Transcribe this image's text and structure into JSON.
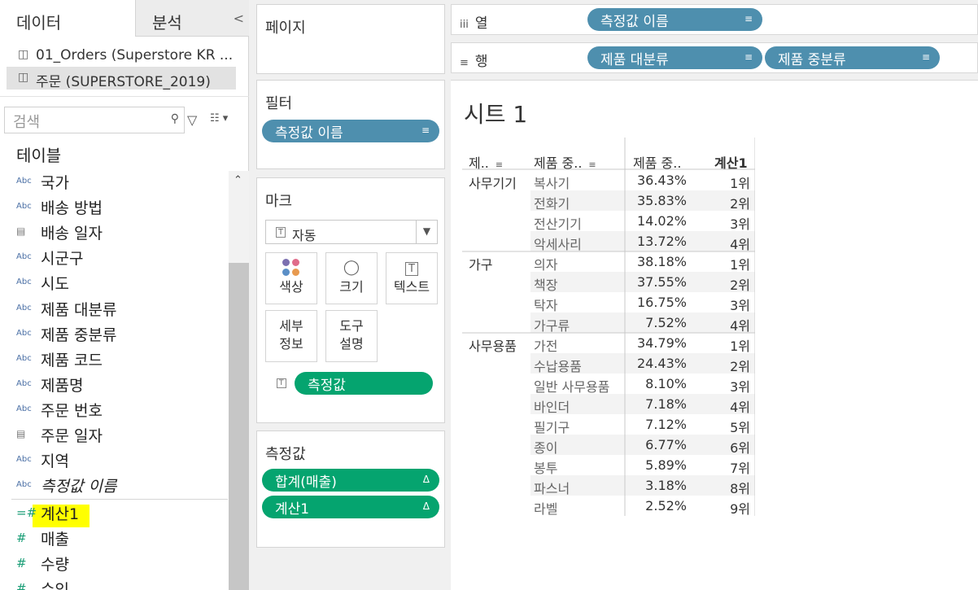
{
  "tabs": {
    "data": "데이터",
    "analysis": "분석",
    "collapse": "<"
  },
  "datasources": [
    "01_Orders (Superstore KR ...",
    "주문 (SUPERSTORE_2019)"
  ],
  "search": {
    "placeholder": "검색"
  },
  "tables_heading": "테이블",
  "fields": [
    {
      "icon": "Abc",
      "name": "국가"
    },
    {
      "icon": "Abc",
      "name": "배송 방법"
    },
    {
      "icon": "cal",
      "name": "배송 일자"
    },
    {
      "icon": "Abc",
      "name": "시군구"
    },
    {
      "icon": "Abc",
      "name": "시도"
    },
    {
      "icon": "Abc",
      "name": "제품 대분류"
    },
    {
      "icon": "Abc",
      "name": "제품 중분류"
    },
    {
      "icon": "Abc",
      "name": "제품 코드"
    },
    {
      "icon": "Abc",
      "name": "제품명"
    },
    {
      "icon": "Abc",
      "name": "주문 번호"
    },
    {
      "icon": "cal",
      "name": "주문 일자"
    },
    {
      "icon": "Abc",
      "name": "지역"
    },
    {
      "icon": "Abc",
      "name": "측정값 이름"
    }
  ],
  "measures": [
    {
      "icon": "=#",
      "name": "계산1"
    },
    {
      "icon": "#",
      "name": "매출"
    },
    {
      "icon": "#",
      "name": "수량"
    },
    {
      "icon": "#",
      "name": "수익"
    }
  ],
  "pages_card": {
    "title": "페이지"
  },
  "filters_card": {
    "title": "필터",
    "pill": "측정값 이름"
  },
  "marks_card": {
    "title": "마크",
    "type": "자동",
    "color": "색상",
    "size": "크기",
    "text": "텍스트",
    "detail_1": "세부",
    "detail_2": "정보",
    "tooltip_1": "도구",
    "tooltip_2": "설명",
    "pill": "측정값"
  },
  "measure_values_card": {
    "title": "측정값",
    "pills": [
      "합계(매출)",
      "계산1"
    ]
  },
  "columns_shelf": {
    "label": "열",
    "pill": "측정값 이름"
  },
  "rows_shelf": {
    "label": "행",
    "pills": [
      "제품 대분류",
      "제품 중분류"
    ]
  },
  "sheet": {
    "title": "시트 1",
    "headers": [
      "제..",
      "제품 중..",
      "제품 중..",
      "계산1"
    ],
    "groups": [
      {
        "category": "사무기기",
        "rows": [
          {
            "sub": "복사기",
            "pct": "36.43%",
            "rank": "1위"
          },
          {
            "sub": "전화기",
            "pct": "35.83%",
            "rank": "2위"
          },
          {
            "sub": "전산기기",
            "pct": "14.02%",
            "rank": "3위"
          },
          {
            "sub": "악세사리",
            "pct": "13.72%",
            "rank": "4위"
          }
        ]
      },
      {
        "category": "가구",
        "rows": [
          {
            "sub": "의자",
            "pct": "38.18%",
            "rank": "1위"
          },
          {
            "sub": "책장",
            "pct": "37.55%",
            "rank": "2위"
          },
          {
            "sub": "탁자",
            "pct": "16.75%",
            "rank": "3위"
          },
          {
            "sub": "가구류",
            "pct": "7.52%",
            "rank": "4위"
          }
        ]
      },
      {
        "category": "사무용품",
        "rows": [
          {
            "sub": "가전",
            "pct": "34.79%",
            "rank": "1위"
          },
          {
            "sub": "수납용품",
            "pct": "24.43%",
            "rank": "2위"
          },
          {
            "sub": "일반 사무용품",
            "pct": "8.10%",
            "rank": "3위"
          },
          {
            "sub": "바인더",
            "pct": "7.18%",
            "rank": "4위"
          },
          {
            "sub": "필기구",
            "pct": "7.12%",
            "rank": "5위"
          },
          {
            "sub": "종이",
            "pct": "6.77%",
            "rank": "6위"
          },
          {
            "sub": "봉투",
            "pct": "5.89%",
            "rank": "7위"
          },
          {
            "sub": "파스너",
            "pct": "3.18%",
            "rank": "8위"
          },
          {
            "sub": "라벨",
            "pct": "2.52%",
            "rank": "9위"
          }
        ]
      }
    ]
  },
  "colors": {
    "dimension_pill": "#4e8fae",
    "measure_pill": "#05a46f",
    "highlight": "#ffff00"
  }
}
